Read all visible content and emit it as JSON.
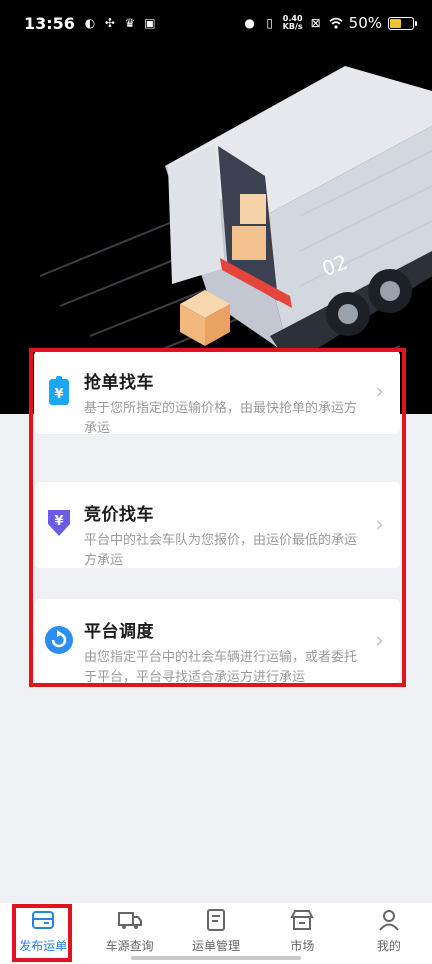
{
  "status_bar": {
    "time": "13:56",
    "net_speed_value": "0.40",
    "net_speed_unit": "KB/s",
    "battery": "50%"
  },
  "hero": {
    "truck_label": "02"
  },
  "cards": [
    {
      "title": "抢单找车",
      "desc": "基于您所指定的运输价格，由最快抢单的承运方承运",
      "icon": "grab-order-icon"
    },
    {
      "title": "竞价找车",
      "desc": "平台中的社会车队为您报价，由运价最低的承运方承运",
      "icon": "bid-icon"
    },
    {
      "title": "平台调度",
      "desc": "由您指定平台中的社会车辆进行运输，或者委托于平台，平台寻找适合承运方进行承运",
      "icon": "dispatch-icon"
    }
  ],
  "bottom_nav": [
    {
      "label": "发布运单",
      "icon": "publish-order-icon",
      "active": true
    },
    {
      "label": "车源查询",
      "icon": "truck-search-icon",
      "active": false
    },
    {
      "label": "运单管理",
      "icon": "order-manage-icon",
      "active": false
    },
    {
      "label": "市场",
      "icon": "market-icon",
      "active": false
    },
    {
      "label": "我的",
      "icon": "profile-icon",
      "active": false
    }
  ],
  "colors": {
    "accent": "#2b7fe8",
    "highlight": "#e0141e"
  }
}
